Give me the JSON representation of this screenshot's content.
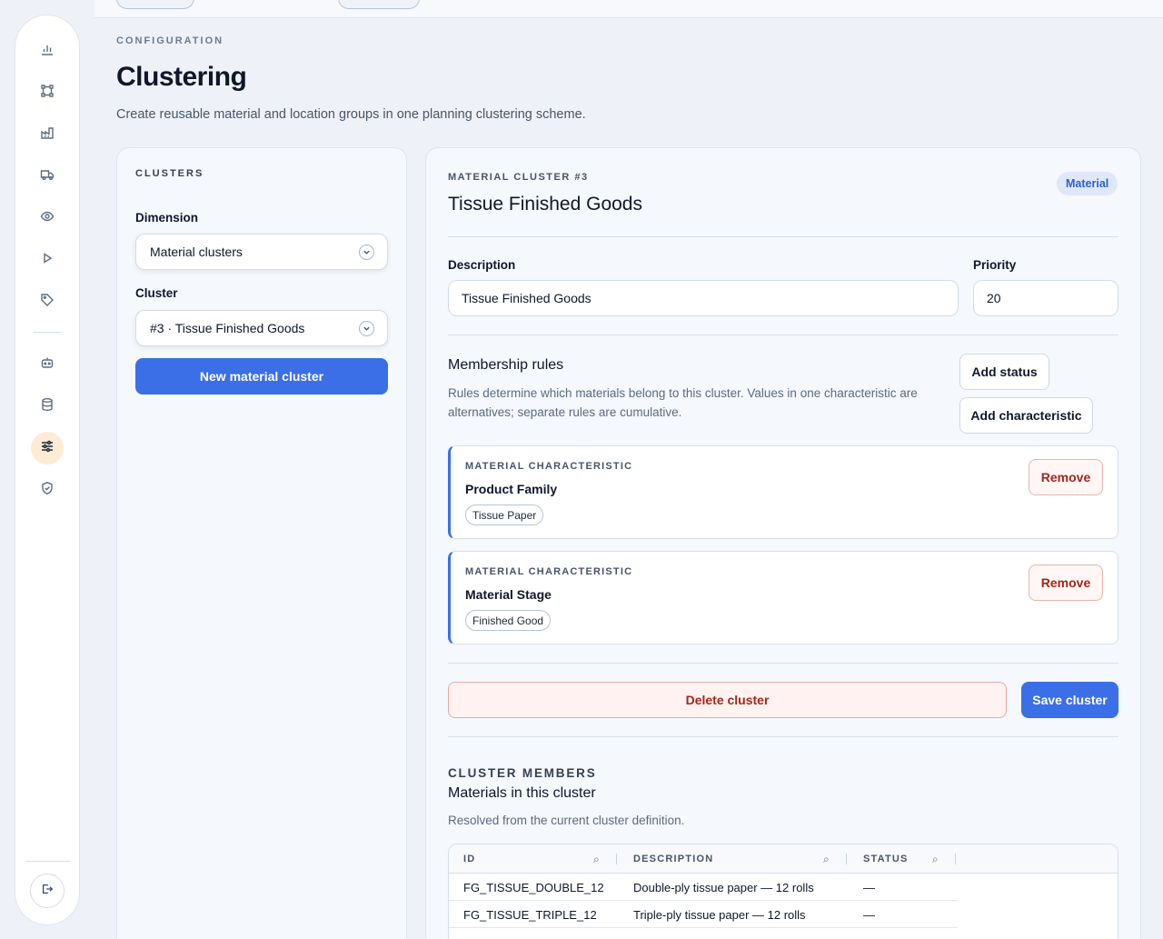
{
  "rail": {
    "items": [
      {
        "icon": "bar-chart-icon"
      },
      {
        "icon": "network-icon"
      },
      {
        "icon": "factory-icon"
      },
      {
        "icon": "truck-icon"
      },
      {
        "icon": "eye-icon"
      },
      {
        "icon": "play-icon"
      },
      {
        "icon": "tag-icon"
      },
      {
        "icon": "robot-icon"
      },
      {
        "icon": "database-icon"
      },
      {
        "icon": "sliders-icon",
        "active": true
      },
      {
        "icon": "shield-icon"
      }
    ],
    "logout_icon": "logout-icon"
  },
  "header": {
    "eyebrow": "CONFIGURATION",
    "title": "Clustering",
    "subtitle": "Create reusable material and location groups in one planning clustering scheme."
  },
  "left": {
    "eyebrow": "CLUSTERS",
    "dimension_label": "Dimension",
    "dimension_value": "Material clusters",
    "cluster_label": "Cluster",
    "cluster_value": "#3 · Tissue Finished Goods",
    "new_button": "New material cluster"
  },
  "detail": {
    "eyebrow": "MATERIAL CLUSTER #3",
    "title": "Tissue Finished Goods",
    "badge": "Material",
    "description_label": "Description",
    "description_value": "Tissue Finished Goods",
    "priority_label": "Priority",
    "priority_value": "20",
    "rules_title": "Membership rules",
    "rules_help": "Rules determine which materials belong to this cluster. Values in one characteristic are alternatives; separate rules are cumulative.",
    "add_status": "Add status",
    "add_characteristic": "Add characteristic",
    "rules": [
      {
        "eyebrow": "MATERIAL CHARACTERISTIC",
        "name": "Product Family",
        "value": "Tissue Paper",
        "remove": "Remove"
      },
      {
        "eyebrow": "MATERIAL CHARACTERISTIC",
        "name": "Material Stage",
        "value": "Finished Good",
        "remove": "Remove"
      }
    ],
    "delete_button": "Delete cluster",
    "save_button": "Save cluster",
    "members_eyebrow": "CLUSTER MEMBERS",
    "members_title": "Materials in this cluster",
    "members_sub": "Resolved from the current cluster definition.",
    "table": {
      "columns": [
        "ID",
        "DESCRIPTION",
        "STATUS"
      ],
      "rows": [
        [
          "FG_TISSUE_DOUBLE_12",
          "Double-ply tissue paper — 12 rolls",
          "—"
        ],
        [
          "FG_TISSUE_TRIPLE_12",
          "Triple-ply tissue paper — 12 rolls",
          "—"
        ]
      ]
    }
  }
}
